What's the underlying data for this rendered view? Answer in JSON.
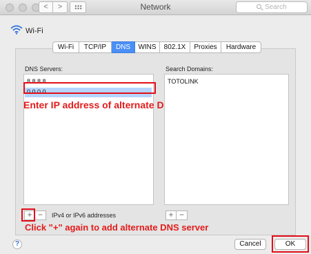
{
  "window": {
    "title": "Network",
    "search_placeholder": "Search"
  },
  "titlebar": {
    "back_glyph": "<",
    "forward_glyph": ">"
  },
  "interface": {
    "name": "Wi-Fi"
  },
  "tabs": [
    {
      "label": "Wi-Fi",
      "active": false
    },
    {
      "label": "TCP/IP",
      "active": false
    },
    {
      "label": "DNS",
      "active": true
    },
    {
      "label": "WINS",
      "active": false
    },
    {
      "label": "802.1X",
      "active": false
    },
    {
      "label": "Proxies",
      "active": false
    },
    {
      "label": "Hardware",
      "active": false
    }
  ],
  "dns": {
    "label": "DNS Servers:",
    "items": [
      "8.8.8.8",
      "0.0.0.0"
    ],
    "hint": "IPv4 or IPv6 addresses"
  },
  "search_domains": {
    "label": "Search Domains:",
    "items": [
      "TOTOLINK"
    ]
  },
  "controls": {
    "add": "+",
    "remove": "−"
  },
  "annotations": {
    "enter_ip": "Enter IP address of alternate DNS server",
    "click_plus": "Click \"+\" again to add alternate DNS server",
    "color": "#e31b1b"
  },
  "buttons": {
    "help": "?",
    "cancel": "Cancel",
    "ok": "OK"
  }
}
